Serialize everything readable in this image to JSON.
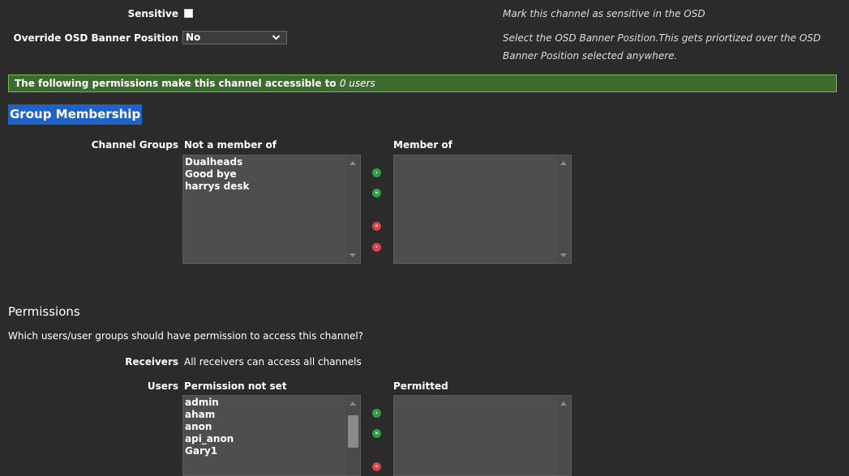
{
  "sensitive": {
    "label": "Sensitive",
    "help": "Mark this channel as sensitive in the OSD"
  },
  "osd_banner": {
    "label": "Override OSD Banner Position",
    "value": "No",
    "help_line1": "Select the OSD Banner Position.This gets priortized over the OSD",
    "help_line2": "Banner Position selected anywhere."
  },
  "banner": {
    "text": "The following permissions make this channel accessible to ",
    "count": "0 users"
  },
  "group_membership": {
    "title": "Group Membership",
    "row_label": "Channel Groups",
    "not_member_header": "Not a member of",
    "member_header": "Member of",
    "not_member_items": [
      "Dualheads",
      "Good bye",
      "harrys desk"
    ],
    "member_items": []
  },
  "permissions": {
    "title": "Permissions",
    "question": "Which users/user groups should have permission to access this channel?",
    "receivers_label": "Receivers",
    "receivers_value": "All receivers can access all channels",
    "users_label": "Users",
    "not_set_header": "Permission not set",
    "permitted_header": "Permitted",
    "not_set_items": [
      "admin",
      "aham",
      "anon",
      "api_anon",
      "Gary1"
    ],
    "permitted_items": []
  },
  "icons": {
    "add": "arrow-right-icon",
    "add_all": "double-arrow-right-icon",
    "remove_all": "double-arrow-left-icon",
    "remove": "arrow-left-icon"
  },
  "colors": {
    "background": "#2b2b2b",
    "banner_bg": "#3d6b2f",
    "banner_border": "#6fbf4a",
    "highlight": "#1f63c6",
    "add_green": "#2e9e49",
    "remove_red": "#d9434a"
  }
}
